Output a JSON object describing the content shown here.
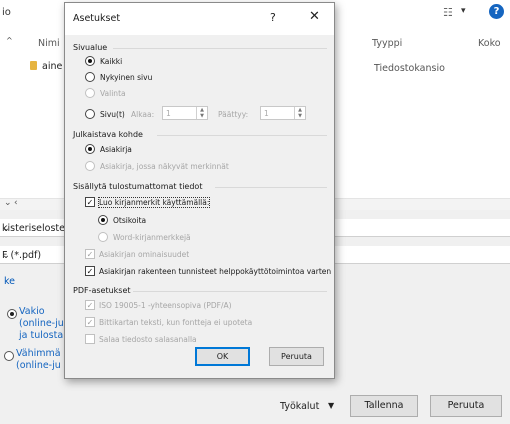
{
  "background_dialog": {
    "title_fragment": "io",
    "view_icon": "view-options-icon",
    "help_icon": "?",
    "columns": {
      "name": "Nimi",
      "type": "Tyyppi",
      "size": "Koko"
    },
    "files": [
      {
        "name": "aine",
        "type": "Tiedostokansio"
      }
    ],
    "file_name_value": "kisteriseloste.p",
    "file_type_value": "F (*.pdf)",
    "link_text": "ke",
    "radios": [
      {
        "label_lines": [
          "Vakio",
          "(online-ju",
          "ja tulosta"
        ],
        "selected": true
      },
      {
        "label_lines": [
          "Vähimmä",
          "(online-ju"
        ],
        "selected": false
      }
    ],
    "tools_label": "Työkalut",
    "save_label": "Tallenna",
    "cancel_label": "Peruuta"
  },
  "options_dialog": {
    "title": "Asetukset",
    "help_label": "?",
    "close_label": "✕",
    "page_range": {
      "group_label": "Sivualue",
      "all": "Kaikki",
      "current": "Nykyinen sivu",
      "selection": "Valinta",
      "pages": "Sivu(t)",
      "from_label": "Alkaa:",
      "from_value": "1",
      "to_label": "Päättyy:",
      "to_value": "1"
    },
    "publish": {
      "group_label": "Julkaistava kohde",
      "document": "Asiakirja",
      "document_markup": "Asiakirja, jossa näkyvät merkinnät"
    },
    "non_printing": {
      "group_label": "Sisällytä tulostumattomat tiedot",
      "create_bookmarks": "Luo kirjanmerkit käyttämällä:",
      "headings": "Otsikoita",
      "word_bookmarks": "Word-kirjanmerkkejä",
      "doc_properties": "Asiakirjan ominaisuudet",
      "structure_tags": "Asiakirjan rakenteen tunnisteet helppokäyttötoimintoa varten"
    },
    "pdf_options": {
      "group_label": "PDF-asetukset",
      "iso": "ISO 19005-1 -yhteensopiva (PDF/A)",
      "bitmap_text": "Bittikartan teksti, kun fontteja ei upoteta",
      "encrypt": "Salaa tiedosto salasanalla"
    },
    "ok_label": "OK",
    "cancel_label": "Peruuta",
    "accent_color": "#0078d7"
  }
}
